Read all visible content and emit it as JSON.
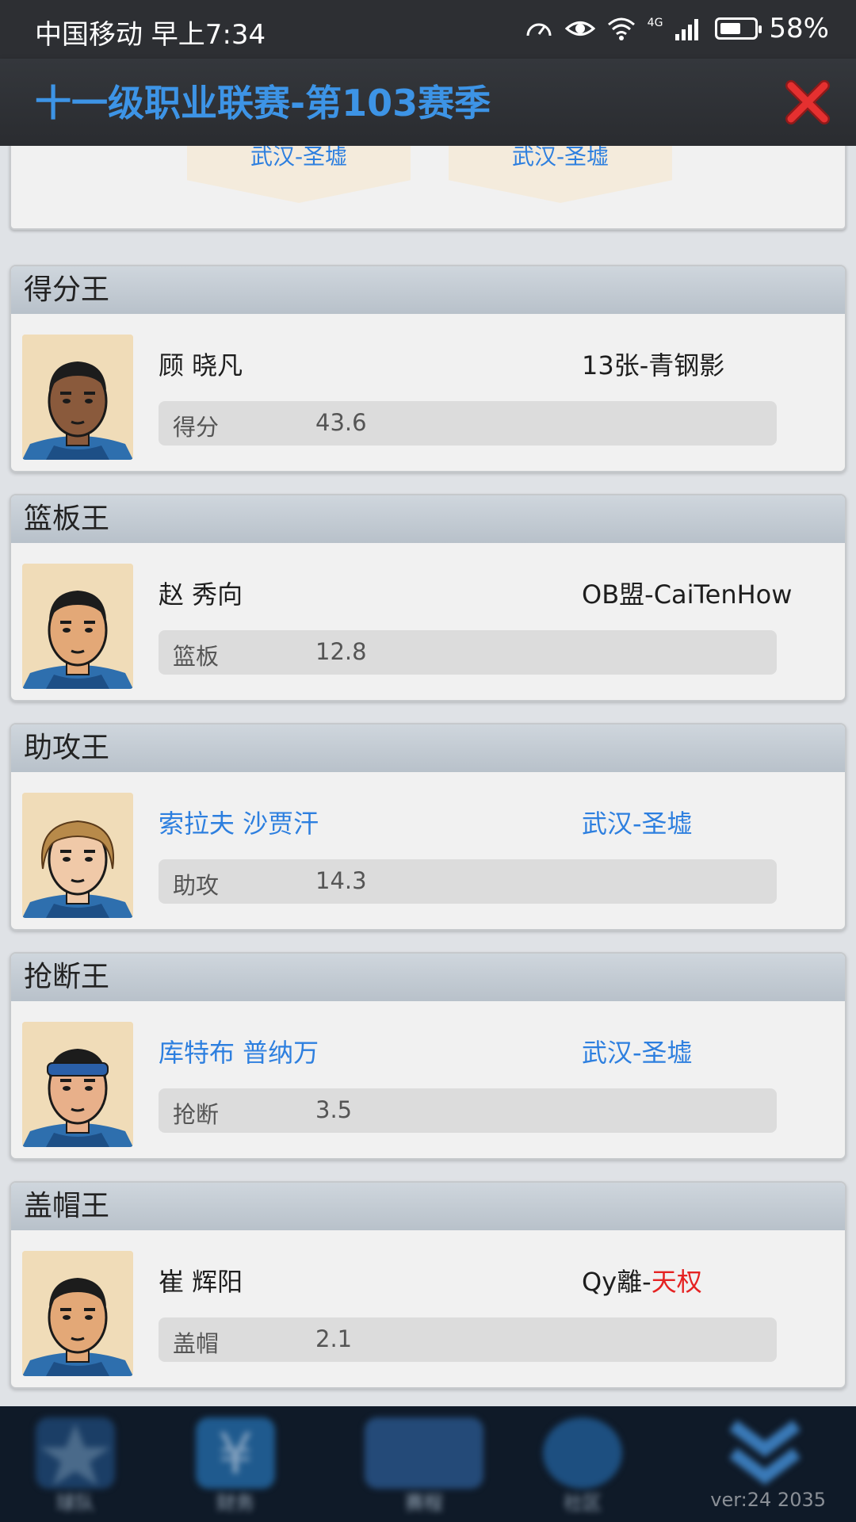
{
  "status_bar": {
    "carrier_time": "中国移动 早上7:34",
    "network": "4G",
    "battery_percent": "58%",
    "battery_level": 0.58
  },
  "header": {
    "title": "十一级职业联赛-第103赛季"
  },
  "top_card": {
    "pennants": [
      "武汉-圣墟",
      "武汉-圣墟"
    ]
  },
  "awards": [
    {
      "header": "得分王",
      "player": "顾 晓凡",
      "player_color": "#1e1e1e",
      "team_prefix": "13张-青钢影",
      "team_suffix": "",
      "team_color": "#1e1e1e",
      "stat_label": "得分",
      "stat_value": "43.6",
      "avatar": {
        "skin": "#8a5a3c",
        "hair": "#1c1c1c",
        "headband": false
      }
    },
    {
      "header": "篮板王",
      "player": "赵 秀向",
      "player_color": "#1e1e1e",
      "team_prefix": "OB盟-CaiTenHow",
      "team_suffix": "",
      "team_color": "#1e1e1e",
      "stat_label": "篮板",
      "stat_value": "12.8",
      "avatar": {
        "skin": "#e3a877",
        "hair": "#1c1c1c",
        "headband": false
      }
    },
    {
      "header": "助攻王",
      "player": "索拉夫 沙贾汗",
      "player_color": "#2d7fdf",
      "team_prefix": "武汉-圣墟",
      "team_suffix": "",
      "team_color": "#2d7fdf",
      "stat_label": "助攻",
      "stat_value": "14.3",
      "avatar": {
        "skin": "#f0c9a8",
        "hair": "#b88a4a",
        "headband": false
      }
    },
    {
      "header": "抢断王",
      "player": "库特布 普纳万",
      "player_color": "#2d7fdf",
      "team_prefix": "武汉-圣墟",
      "team_suffix": "",
      "team_color": "#2d7fdf",
      "stat_label": "抢断",
      "stat_value": "3.5",
      "avatar": {
        "skin": "#e8b08a",
        "hair": "#1c1c1c",
        "headband": true
      }
    },
    {
      "header": "盖帽王",
      "player": "崔 辉阳",
      "player_color": "#1e1e1e",
      "team_prefix": "Qy離-",
      "team_suffix": "天权",
      "team_color": "#1e1e1e",
      "stat_label": "盖帽",
      "stat_value": "2.1",
      "avatar": {
        "skin": "#e3a877",
        "hair": "#1c1c1c",
        "headband": false
      }
    }
  ],
  "bottom_nav": {
    "items": [
      {
        "icon": "star-icon",
        "label": "球队"
      },
      {
        "icon": "yen-icon",
        "label": "财务"
      },
      {
        "icon": "court-icon",
        "label": "赛程"
      },
      {
        "icon": "chat-icon",
        "label": "社区"
      },
      {
        "icon": "chevron-down-icon",
        "label": ""
      }
    ],
    "version": "ver:24  2035"
  }
}
